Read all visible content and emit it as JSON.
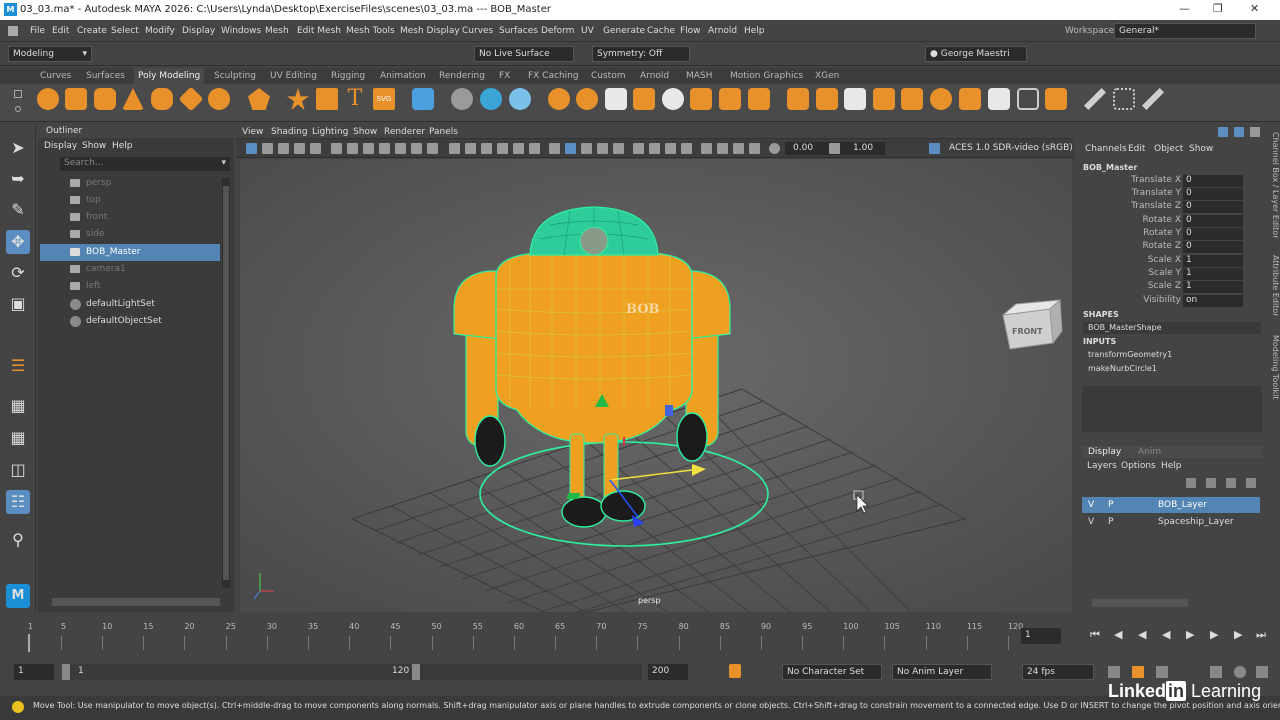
{
  "window": {
    "title": "03_03.ma* - Autodesk MAYA 2026: C:\\Users\\Lynda\\Desktop\\ExerciseFiles\\scenes\\03_03.ma  ---  BOB_Master",
    "app_icon": "M"
  },
  "menu": [
    "File",
    "Edit",
    "Create",
    "Select",
    "Modify",
    "Display",
    "Windows",
    "Mesh",
    "Edit Mesh",
    "Mesh Tools",
    "Mesh Display",
    "Curves",
    "Surfaces",
    "Deform",
    "UV",
    "Generate",
    "Cache",
    "Flow",
    "Arnold",
    "Help"
  ],
  "workspace": {
    "label": "Workspace:",
    "value": "General*"
  },
  "status": {
    "mode": "Modeling",
    "live_surface": "No Live Surface",
    "symmetry": "Symmetry: Off",
    "user": "George Maestri"
  },
  "shelf_tabs": [
    "Curves",
    "Surfaces",
    "Poly Modeling",
    "Sculpting",
    "UV Editing",
    "Rigging",
    "Animation",
    "Rendering",
    "FX",
    "FX Caching",
    "Custom",
    "Arnold",
    "MASH",
    "Motion Graphics",
    "XGen"
  ],
  "shelf_active": "Poly Modeling",
  "outliner": {
    "title": "Outliner",
    "menu": [
      "Display",
      "Show",
      "Help"
    ],
    "search_placeholder": "Search...",
    "items": [
      {
        "label": "persp",
        "dim": true
      },
      {
        "label": "top",
        "dim": true
      },
      {
        "label": "front",
        "dim": true
      },
      {
        "label": "side",
        "dim": true
      },
      {
        "label": "BOB_Master",
        "selected": true
      },
      {
        "label": "camera1",
        "dim": true
      },
      {
        "label": "left",
        "dim": true
      },
      {
        "label": "defaultLightSet"
      },
      {
        "label": "defaultObjectSet"
      }
    ]
  },
  "viewport": {
    "menu": [
      "View",
      "Shading",
      "Lighting",
      "Show",
      "Renderer",
      "Panels"
    ],
    "exposure": "0.00",
    "gamma": "1.00",
    "colorspace": "ACES 1.0 SDR-video (sRGB)",
    "camera_label": "persp",
    "viewcube": "FRONT",
    "model_text": "BOB"
  },
  "channel_box": {
    "menu": [
      "Channels",
      "Edit",
      "Object",
      "Show"
    ],
    "object": "BOB_Master",
    "attributes": [
      {
        "name": "Translate X",
        "value": "0"
      },
      {
        "name": "Translate Y",
        "value": "0"
      },
      {
        "name": "Translate Z",
        "value": "0"
      },
      {
        "name": "Rotate X",
        "value": "0"
      },
      {
        "name": "Rotate Y",
        "value": "0"
      },
      {
        "name": "Rotate Z",
        "value": "0"
      },
      {
        "name": "Scale X",
        "value": "1"
      },
      {
        "name": "Scale Y",
        "value": "1"
      },
      {
        "name": "Scale Z",
        "value": "1"
      },
      {
        "name": "Visibility",
        "value": "on"
      }
    ],
    "shapes_label": "SHAPES",
    "shape": "BOB_MasterShape",
    "inputs_label": "INPUTS",
    "inputs": [
      "transformGeometry1",
      "makeNurbCircle1"
    ]
  },
  "layers": {
    "tabs": [
      "Display",
      "Anim"
    ],
    "menu": [
      "Layers",
      "Options",
      "Help"
    ],
    "items": [
      {
        "v": "V",
        "p": "P",
        "name": "BOB_Layer",
        "selected": true
      },
      {
        "v": "V",
        "p": "P",
        "name": "Spaceship_Layer"
      }
    ]
  },
  "side_tabs": [
    "Channel Box / Layer Editor",
    "Attribute Editor",
    "Modeling Toolkit"
  ],
  "timeline": {
    "ticks": [
      "1",
      "5",
      "10",
      "15",
      "20",
      "25",
      "30",
      "35",
      "40",
      "45",
      "50",
      "55",
      "60",
      "65",
      "70",
      "75",
      "80",
      "85",
      "90",
      "95",
      "100",
      "105",
      "110",
      "115",
      "120"
    ],
    "current_frame": "1"
  },
  "range": {
    "start": "1",
    "inner_start": "1",
    "inner_end": "120",
    "end": "200",
    "character_set": "No Character Set",
    "anim_layer": "No Anim Layer",
    "fps": "24 fps"
  },
  "help_line": "Move Tool: Use manipulator to move object(s). Ctrl+middle-drag to move components along normals. Shift+drag manipulator axis or plane handles to extrude components or clone objects. Ctrl+Shift+drag to constrain movement to a connected edge. Use D or INSERT to change the pivot position and axis orientation.",
  "watermark": {
    "a": "Linked",
    "b": "in",
    "c": " Learning"
  },
  "colors": {
    "accent": "#5285b3",
    "mesh_orange": "#f0a020",
    "wire_green": "#2ef0a0"
  }
}
